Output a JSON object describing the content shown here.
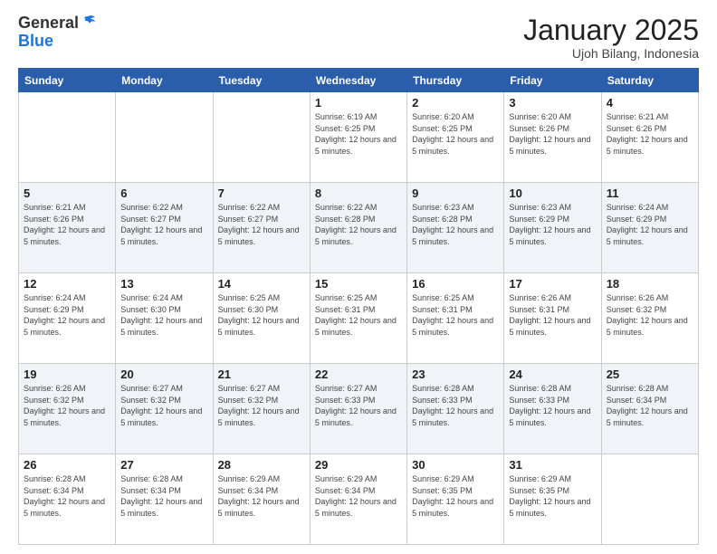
{
  "header": {
    "logo_general": "General",
    "logo_blue": "Blue",
    "month_title": "January 2025",
    "location": "Ujoh Bilang, Indonesia"
  },
  "days_of_week": [
    "Sunday",
    "Monday",
    "Tuesday",
    "Wednesday",
    "Thursday",
    "Friday",
    "Saturday"
  ],
  "weeks": [
    [
      {
        "day": "",
        "info": ""
      },
      {
        "day": "",
        "info": ""
      },
      {
        "day": "",
        "info": ""
      },
      {
        "day": "1",
        "info": "Sunrise: 6:19 AM\nSunset: 6:25 PM\nDaylight: 12 hours and 5 minutes."
      },
      {
        "day": "2",
        "info": "Sunrise: 6:20 AM\nSunset: 6:25 PM\nDaylight: 12 hours and 5 minutes."
      },
      {
        "day": "3",
        "info": "Sunrise: 6:20 AM\nSunset: 6:26 PM\nDaylight: 12 hours and 5 minutes."
      },
      {
        "day": "4",
        "info": "Sunrise: 6:21 AM\nSunset: 6:26 PM\nDaylight: 12 hours and 5 minutes."
      }
    ],
    [
      {
        "day": "5",
        "info": "Sunrise: 6:21 AM\nSunset: 6:26 PM\nDaylight: 12 hours and 5 minutes."
      },
      {
        "day": "6",
        "info": "Sunrise: 6:22 AM\nSunset: 6:27 PM\nDaylight: 12 hours and 5 minutes."
      },
      {
        "day": "7",
        "info": "Sunrise: 6:22 AM\nSunset: 6:27 PM\nDaylight: 12 hours and 5 minutes."
      },
      {
        "day": "8",
        "info": "Sunrise: 6:22 AM\nSunset: 6:28 PM\nDaylight: 12 hours and 5 minutes."
      },
      {
        "day": "9",
        "info": "Sunrise: 6:23 AM\nSunset: 6:28 PM\nDaylight: 12 hours and 5 minutes."
      },
      {
        "day": "10",
        "info": "Sunrise: 6:23 AM\nSunset: 6:29 PM\nDaylight: 12 hours and 5 minutes."
      },
      {
        "day": "11",
        "info": "Sunrise: 6:24 AM\nSunset: 6:29 PM\nDaylight: 12 hours and 5 minutes."
      }
    ],
    [
      {
        "day": "12",
        "info": "Sunrise: 6:24 AM\nSunset: 6:29 PM\nDaylight: 12 hours and 5 minutes."
      },
      {
        "day": "13",
        "info": "Sunrise: 6:24 AM\nSunset: 6:30 PM\nDaylight: 12 hours and 5 minutes."
      },
      {
        "day": "14",
        "info": "Sunrise: 6:25 AM\nSunset: 6:30 PM\nDaylight: 12 hours and 5 minutes."
      },
      {
        "day": "15",
        "info": "Sunrise: 6:25 AM\nSunset: 6:31 PM\nDaylight: 12 hours and 5 minutes."
      },
      {
        "day": "16",
        "info": "Sunrise: 6:25 AM\nSunset: 6:31 PM\nDaylight: 12 hours and 5 minutes."
      },
      {
        "day": "17",
        "info": "Sunrise: 6:26 AM\nSunset: 6:31 PM\nDaylight: 12 hours and 5 minutes."
      },
      {
        "day": "18",
        "info": "Sunrise: 6:26 AM\nSunset: 6:32 PM\nDaylight: 12 hours and 5 minutes."
      }
    ],
    [
      {
        "day": "19",
        "info": "Sunrise: 6:26 AM\nSunset: 6:32 PM\nDaylight: 12 hours and 5 minutes."
      },
      {
        "day": "20",
        "info": "Sunrise: 6:27 AM\nSunset: 6:32 PM\nDaylight: 12 hours and 5 minutes."
      },
      {
        "day": "21",
        "info": "Sunrise: 6:27 AM\nSunset: 6:32 PM\nDaylight: 12 hours and 5 minutes."
      },
      {
        "day": "22",
        "info": "Sunrise: 6:27 AM\nSunset: 6:33 PM\nDaylight: 12 hours and 5 minutes."
      },
      {
        "day": "23",
        "info": "Sunrise: 6:28 AM\nSunset: 6:33 PM\nDaylight: 12 hours and 5 minutes."
      },
      {
        "day": "24",
        "info": "Sunrise: 6:28 AM\nSunset: 6:33 PM\nDaylight: 12 hours and 5 minutes."
      },
      {
        "day": "25",
        "info": "Sunrise: 6:28 AM\nSunset: 6:34 PM\nDaylight: 12 hours and 5 minutes."
      }
    ],
    [
      {
        "day": "26",
        "info": "Sunrise: 6:28 AM\nSunset: 6:34 PM\nDaylight: 12 hours and 5 minutes."
      },
      {
        "day": "27",
        "info": "Sunrise: 6:28 AM\nSunset: 6:34 PM\nDaylight: 12 hours and 5 minutes."
      },
      {
        "day": "28",
        "info": "Sunrise: 6:29 AM\nSunset: 6:34 PM\nDaylight: 12 hours and 5 minutes."
      },
      {
        "day": "29",
        "info": "Sunrise: 6:29 AM\nSunset: 6:34 PM\nDaylight: 12 hours and 5 minutes."
      },
      {
        "day": "30",
        "info": "Sunrise: 6:29 AM\nSunset: 6:35 PM\nDaylight: 12 hours and 5 minutes."
      },
      {
        "day": "31",
        "info": "Sunrise: 6:29 AM\nSunset: 6:35 PM\nDaylight: 12 hours and 5 minutes."
      },
      {
        "day": "",
        "info": ""
      }
    ]
  ]
}
